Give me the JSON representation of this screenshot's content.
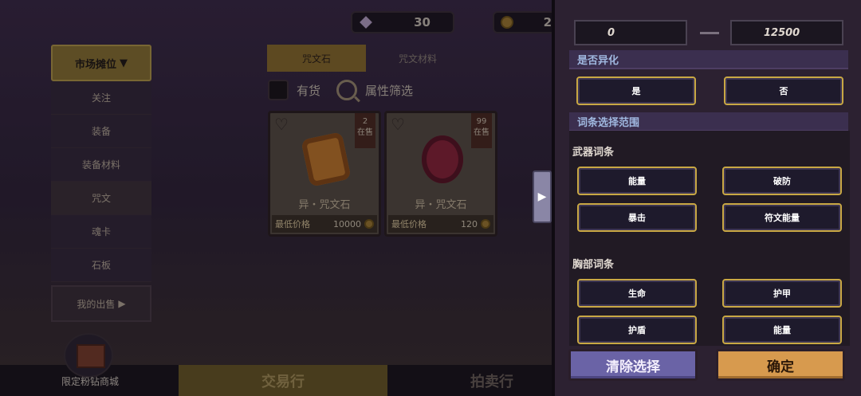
{
  "currency": {
    "gems_amount": "30",
    "coins_amount": "2"
  },
  "sidebar": {
    "header": "市场摊位",
    "items": [
      {
        "label": "关注"
      },
      {
        "label": "装备"
      },
      {
        "label": "装备材料"
      },
      {
        "label": "咒文"
      },
      {
        "label": "魂卡"
      },
      {
        "label": "石板"
      }
    ],
    "my_sales": "我的出售"
  },
  "tabs": {
    "active": "咒文石",
    "inactive": "咒文材料"
  },
  "filters": {
    "in_stock": "有货",
    "attribute_filter": "属性筛选"
  },
  "cards": [
    {
      "name": "异・咒文石",
      "count": "2",
      "status": "在售",
      "price_label": "最低价格",
      "price": "10000",
      "gem_color": "#c47a2a"
    },
    {
      "name": "异・咒文石",
      "count": "99",
      "status": "在售",
      "price_label": "最低价格",
      "price": "120",
      "gem_color": "#8a2438"
    }
  ],
  "shop": {
    "label": "限定粉钻商城"
  },
  "bottom_tabs": {
    "trade": "交易行",
    "auction": "拍卖行"
  },
  "drawer": {
    "range_min": "0",
    "range_max": "12500",
    "anomaly_section": "是否异化",
    "anomaly_yes": "是",
    "anomaly_no": "否",
    "affix_section": "词条选择范围",
    "weapon_affix_title": "武器词条",
    "weapon_affixes": [
      "能量",
      "破防",
      "暴击",
      "符文能量"
    ],
    "chest_affix_title": "胸部词条",
    "chest_affixes": [
      "生命",
      "护甲",
      "护盾",
      "能量"
    ],
    "clear_button": "清除选择",
    "confirm_button": "确定"
  },
  "colors": {
    "accent_gold": "#c9a844",
    "clear_purple": "#6a63a6",
    "confirm_orange": "#d79a4e"
  }
}
